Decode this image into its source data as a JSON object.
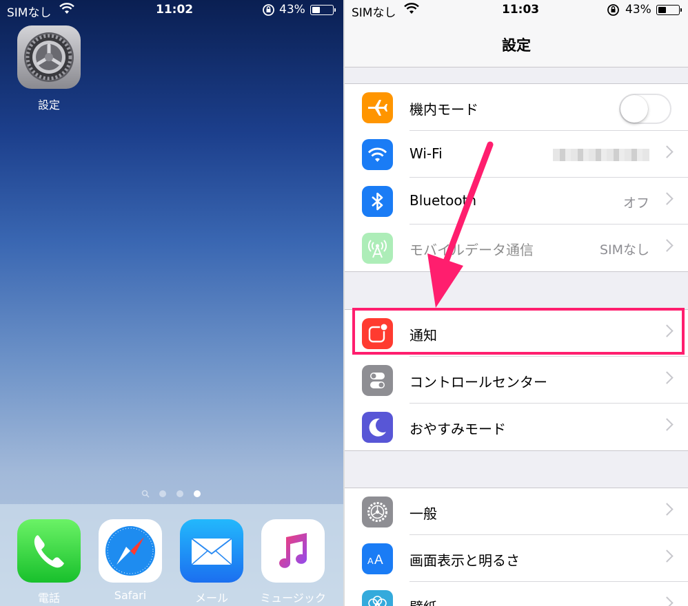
{
  "home": {
    "status": {
      "carrier": "SIMなし",
      "time": "11:02",
      "battery": "43%",
      "battery_level": 0.43
    },
    "settings_app_label": "設定",
    "dock": [
      {
        "label": "電話",
        "icon": "phone-icon"
      },
      {
        "label": "Safari",
        "icon": "safari-icon"
      },
      {
        "label": "メール",
        "icon": "mail-icon"
      },
      {
        "label": "ミュージック",
        "icon": "music-icon"
      }
    ],
    "page_count": 3,
    "current_page": 3
  },
  "settings": {
    "status": {
      "carrier": "SIMなし",
      "time": "11:03",
      "battery": "43%",
      "battery_level": 0.43
    },
    "title": "設定",
    "groups": [
      [
        {
          "label": "機内モード",
          "icon": "airplane-icon",
          "color": "#ff9500",
          "control": "toggle",
          "toggle_on": false
        },
        {
          "label": "Wi-Fi",
          "icon": "wifi-icon",
          "color": "#1a7cf5",
          "control": "chevron",
          "value_blurred": true
        },
        {
          "label": "Bluetooth",
          "icon": "bluetooth-icon",
          "color": "#1a7cf5",
          "control": "chevron",
          "value": "オフ"
        },
        {
          "label": "モバイルデータ通信",
          "icon": "cellular-icon",
          "color": "#4cd964",
          "control": "chevron",
          "value": "SIMなし",
          "disabled": true
        }
      ],
      [
        {
          "label": "通知",
          "icon": "notification-icon",
          "color": "#ff3b30",
          "control": "chevron",
          "highlighted": true
        },
        {
          "label": "コントロールセンター",
          "icon": "control-center-icon",
          "color": "#8e8e93",
          "control": "chevron"
        },
        {
          "label": "おやすみモード",
          "icon": "moon-icon",
          "color": "#5856d6",
          "control": "chevron"
        }
      ],
      [
        {
          "label": "一般",
          "icon": "gear-icon",
          "color": "#8e8e93",
          "control": "chevron"
        },
        {
          "label": "画面表示と明るさ",
          "icon": "display-icon",
          "color": "#1a7cf5",
          "control": "chevron"
        },
        {
          "label": "壁紙",
          "icon": "wallpaper-icon",
          "color": "#34aadc",
          "control": "chevron"
        }
      ]
    ]
  },
  "annotation": {
    "highlight_color": "#ff1e6e"
  }
}
